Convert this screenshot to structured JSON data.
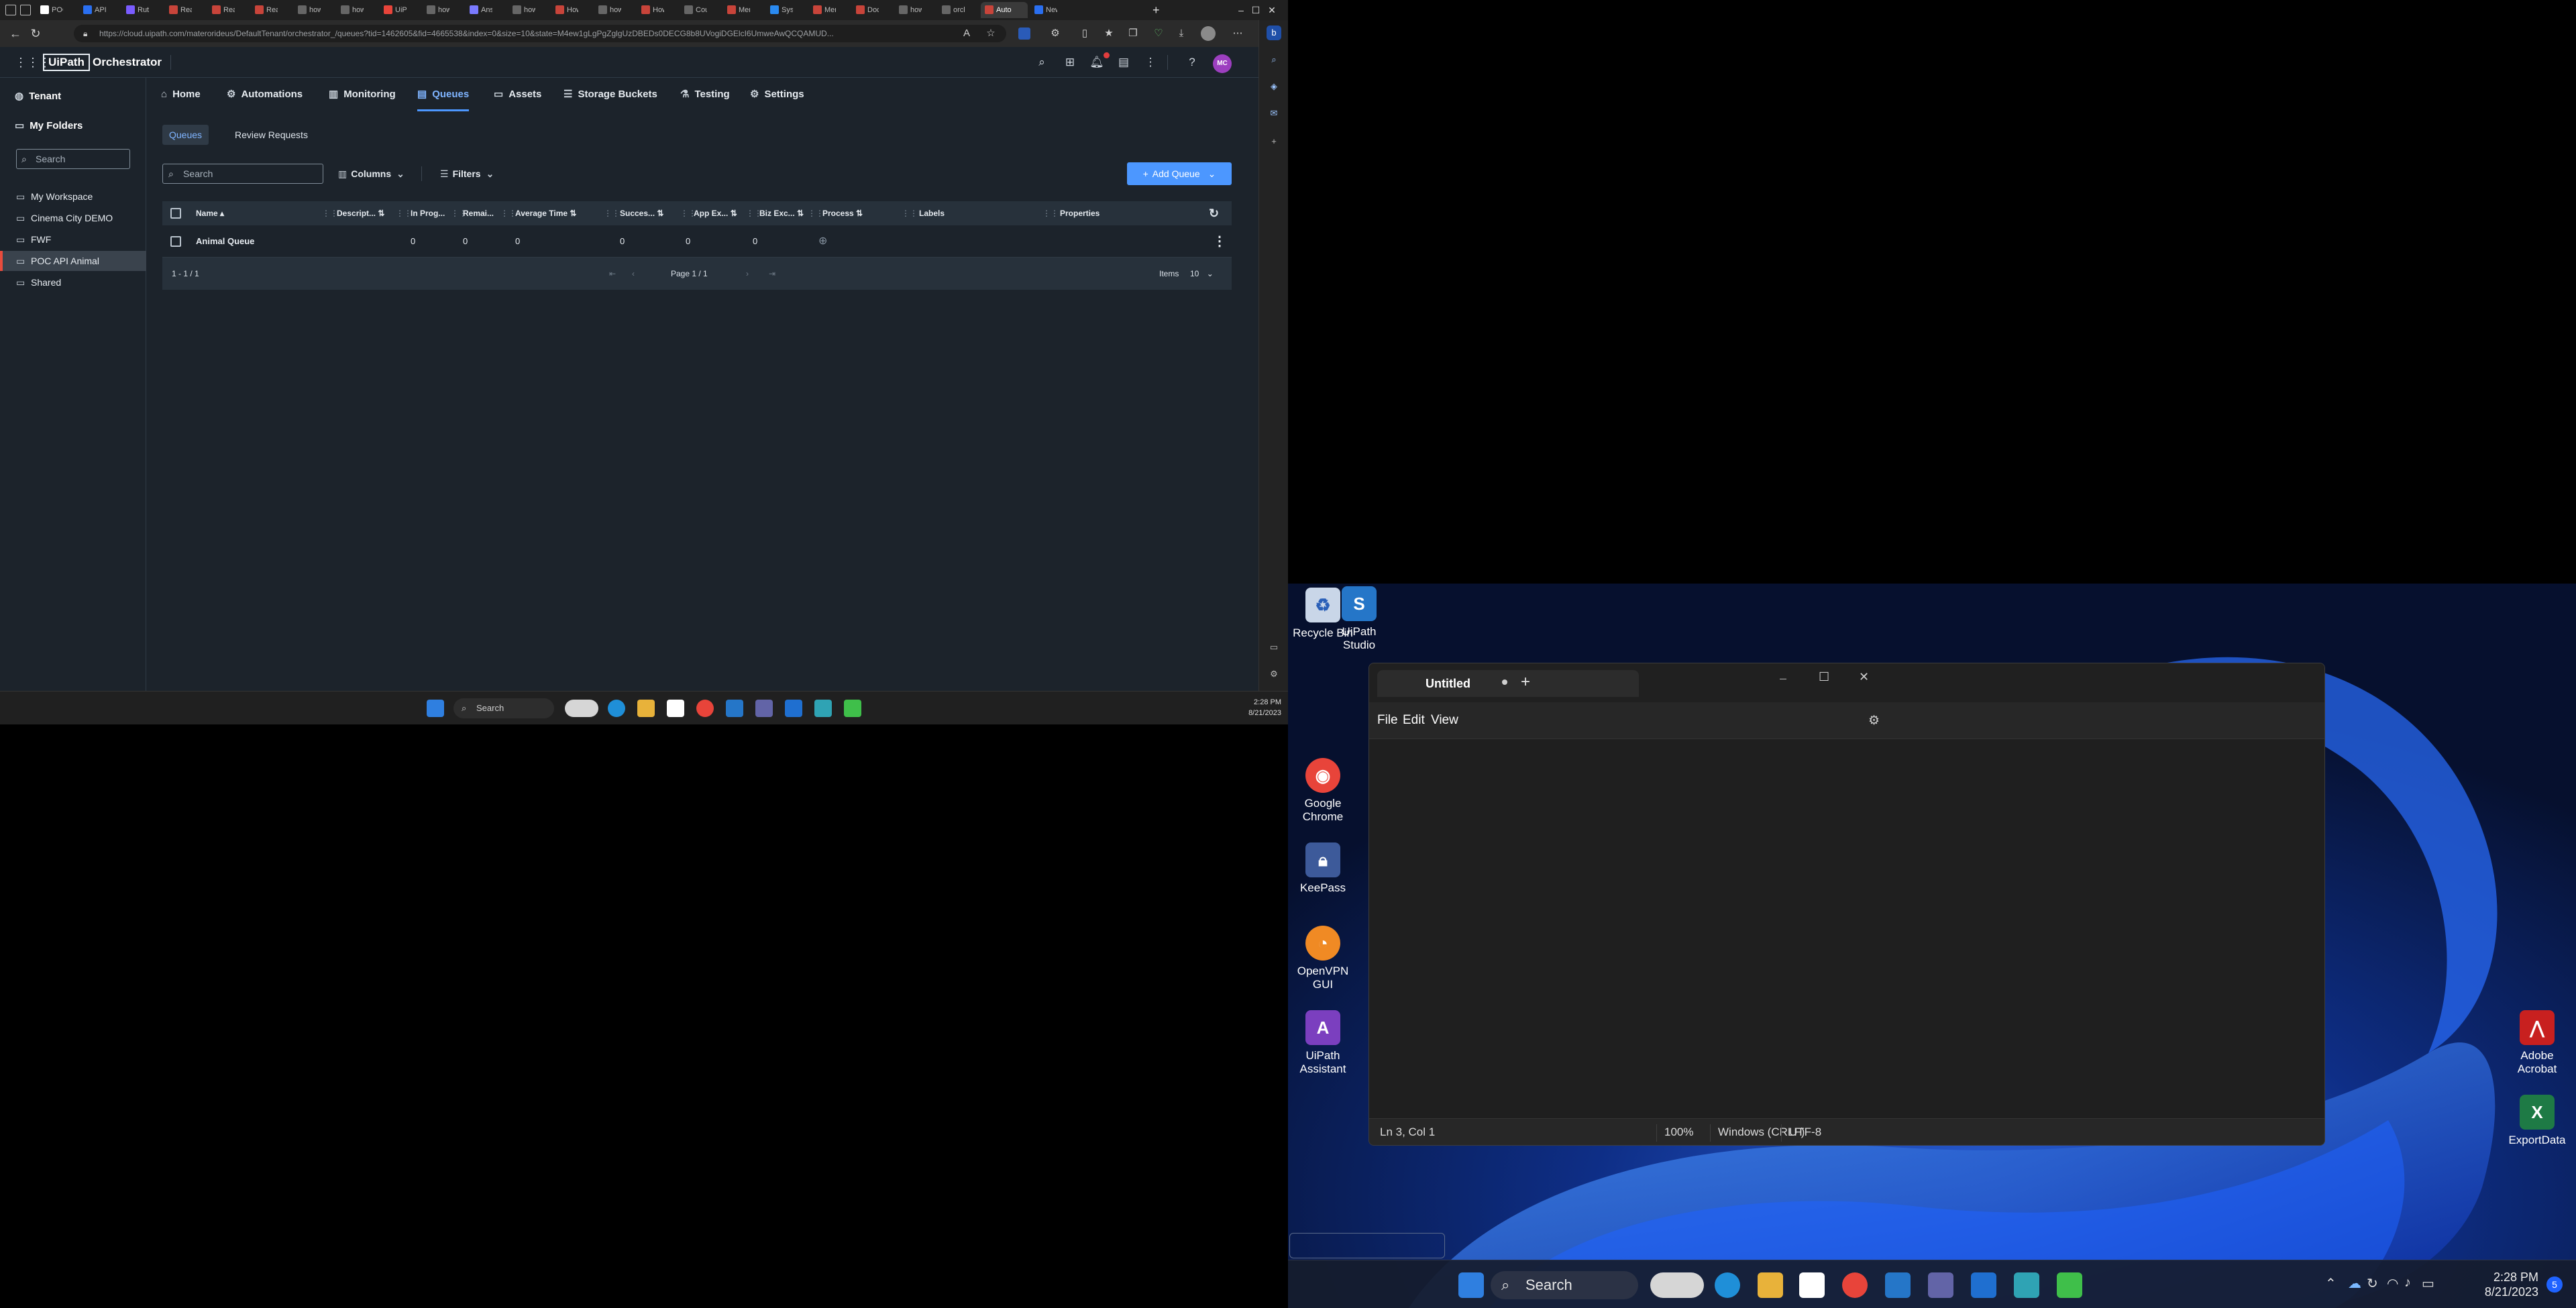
{
  "browser": {
    "tabs": [
      "POC",
      "API |",
      "Rutu",
      "Reac",
      "Reac",
      "Reac",
      "how",
      "how",
      "UiPa",
      "how",
      "Ans",
      "how",
      "How",
      "how",
      "How",
      "Cou",
      "Men",
      "Syst",
      "Men",
      "Doc",
      "how",
      "orch",
      "Auto",
      "New"
    ],
    "url": "https://cloud.uipath.com/materorideus/DefaultTenant/orchestrator_/queues?tid=1462605&fid=4665538&index=0&size=10&state=M4ew1gLgPgZglgUzDBEDs0DECG8b8UVogiDGElcI6UmweAwQCQAMUD...",
    "new_tab": "+",
    "win_min": "–",
    "win_max": "☐",
    "win_close": "✕"
  },
  "app": {
    "brand_logo": "UiPath",
    "brand_name": "Orchestrator",
    "avatar": "MC",
    "tenant": "Tenant",
    "my_folders": "My Folders",
    "folder_search_placeholder": "Search",
    "folders": [
      {
        "label": "My Workspace",
        "selected": false
      },
      {
        "label": "Cinema City DEMO",
        "selected": false
      },
      {
        "label": "FWF",
        "selected": false
      },
      {
        "label": "POC API Animal",
        "selected": true
      },
      {
        "label": "Shared",
        "selected": false
      }
    ],
    "nav": [
      {
        "label": "Home",
        "icon": "home-icon",
        "active": false
      },
      {
        "label": "Automations",
        "icon": "automations-icon",
        "active": false
      },
      {
        "label": "Monitoring",
        "icon": "monitoring-icon",
        "active": false
      },
      {
        "label": "Queues",
        "icon": "queues-icon",
        "active": true
      },
      {
        "label": "Assets",
        "icon": "assets-icon",
        "active": false
      },
      {
        "label": "Storage Buckets",
        "icon": "storage-icon",
        "active": false
      },
      {
        "label": "Testing",
        "icon": "testing-icon",
        "active": false
      },
      {
        "label": "Settings",
        "icon": "settings-icon",
        "active": false
      }
    ],
    "subtabs": [
      "Queues",
      "Review Requests"
    ],
    "search_placeholder": "Search",
    "columns_label": "Columns",
    "filters_label": "Filters",
    "add_queue_label": "Add Queue",
    "columns": [
      "Name",
      "Descript...",
      "In Prog...",
      "Remai...",
      "Average Time",
      "Succes...",
      "App Ex...",
      "Biz Exc...",
      "Process",
      "Labels",
      "Properties"
    ],
    "rows": [
      {
        "name": "Animal Queue",
        "in_progress": "0",
        "remaining": "0",
        "average_time": "0",
        "successful": "0",
        "app_exceptions": "0",
        "biz_exceptions": "0"
      }
    ],
    "footer": {
      "range": "1 - 1 / 1",
      "page": "Page 1 / 1",
      "items_label": "Items",
      "items_value": "10"
    }
  },
  "taskbar_left": {
    "search": "Search",
    "time": "2:28 PM",
    "date": "8/21/2023"
  },
  "desktop": {
    "icons": [
      "Recycle Bin",
      "UiPath Studio",
      "Google Chrome",
      "KeePass",
      "OpenVPN GUI",
      "UiPath Assistant",
      "Adobe Acrobat",
      "ExportData"
    ]
  },
  "notepad": {
    "tab_title": "Untitled",
    "menu": [
      "File",
      "Edit",
      "View"
    ],
    "status": {
      "position": "Ln 3, Col 1",
      "zoom": "100%",
      "line_ending": "Windows (CRLF)",
      "encoding": "UTF-8"
    }
  },
  "taskbar_right": {
    "search": "Search",
    "time": "2:28 PM",
    "date": "8/21/2023"
  }
}
